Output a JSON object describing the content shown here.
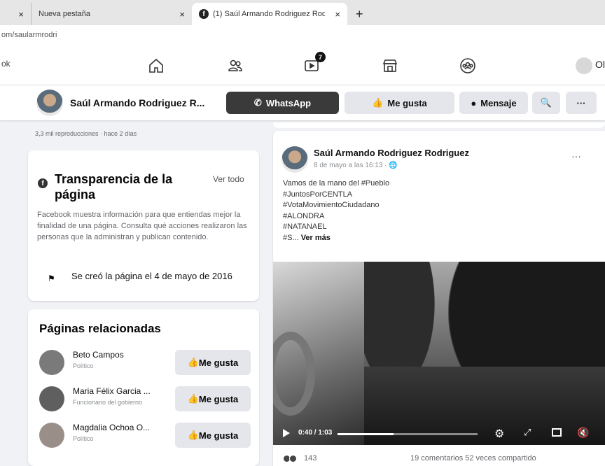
{
  "browser": {
    "tabs": [
      {
        "label": "",
        "close": "×"
      },
      {
        "label": "Nueva pestaña",
        "close": "×"
      },
      {
        "label": "(1) Saúl Armando Rodriguez Rod",
        "close": "×"
      }
    ],
    "new_tab": "+",
    "url": "om/saularmrodri"
  },
  "fbnav": {
    "brand": "ok",
    "icons": [
      "home-icon",
      "friends-icon",
      "watch-icon",
      "marketplace-icon",
      "groups-icon"
    ],
    "watch_badge": "7",
    "profile_label": "Ol"
  },
  "page_header": {
    "name": "Saúl Armando Rodriguez R...",
    "whatsapp": "WhatsApp",
    "like": "Me gusta",
    "message": "Mensaje",
    "search": "🔍",
    "more": "···"
  },
  "snippet": {
    "meta": "3,3 mil reproducciones · hace 2 días"
  },
  "transparency": {
    "title": "Transparencia de la página",
    "link": "Ver todo",
    "description": "Facebook muestra información para que entiendas mejor la finalidad de una página. Consulta qué acciones realizaron las personas que la administran y publican contenido.",
    "created": "Se creó la página el 4 de mayo de 2016"
  },
  "related": {
    "title": "Páginas relacionadas",
    "items": [
      {
        "name": "Beto Campos",
        "sub": "Político",
        "button": "Me gusta"
      },
      {
        "name": "Maria Félix Garcia ...",
        "sub": "Funcionario del gobierno",
        "button": "Me gusta"
      },
      {
        "name": "Magdalia Ochoa O...",
        "sub": "Político",
        "button": "Me gusta"
      }
    ]
  },
  "post": {
    "author": "Saúl Armando Rodriguez Rodriguez",
    "date": "8 de mayo a las 16:13 · ",
    "more": "···",
    "lines": [
      "Vamos de la mano del #Pueblo",
      "#JuntosPorCENTLA",
      "#VotaMovimientoCiudadano",
      "#ALONDRA",
      "#NATANAEL"
    ],
    "last_line_prefix": "#S... ",
    "see_more": "Ver más",
    "video_time": "0:40 / 1:03",
    "video_progress": 0.4,
    "reactions": "143",
    "stats": "19 comentarios  52 veces compartido"
  },
  "colors": {
    "whatsapp_button": "#3a3a3a",
    "secondary_button": "#e4e6eb",
    "page_bg": "#f0f2f5"
  }
}
